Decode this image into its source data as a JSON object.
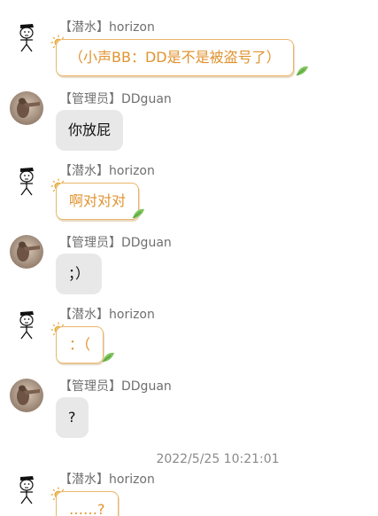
{
  "colors": {
    "bubble_gray": "#e8e8e8",
    "bubble_yellow_text": "#e0932f",
    "bubble_yellow_border": "#e9b66a",
    "sender_text": "#6f6f6f",
    "timestamp_text": "#8a8a8a"
  },
  "messages": [
    {
      "sender": "【潜水】horizon",
      "avatar": "sketch-face-avatar",
      "style": "yellow",
      "text": "（小声BB：DD是不是被盗号了）"
    },
    {
      "sender": "【管理员】DDguan",
      "avatar": "photo-avatar",
      "style": "gray",
      "text": "你放屁"
    },
    {
      "sender": "【潜水】horizon",
      "avatar": "sketch-face-avatar",
      "style": "yellow",
      "text": "啊对对对"
    },
    {
      "sender": "【管理员】DDguan",
      "avatar": "photo-avatar",
      "style": "gray",
      "text": "；）"
    },
    {
      "sender": "【潜水】horizon",
      "avatar": "sketch-face-avatar",
      "style": "yellow",
      "text": "：（"
    },
    {
      "sender": "【管理员】DDguan",
      "avatar": "photo-avatar",
      "style": "gray",
      "text": "?"
    },
    {
      "sender": "【潜水】horizon",
      "avatar": "sketch-face-avatar",
      "style": "yellow",
      "text": "……?"
    }
  ],
  "timestamp": "2022/5/25 10:21:01"
}
